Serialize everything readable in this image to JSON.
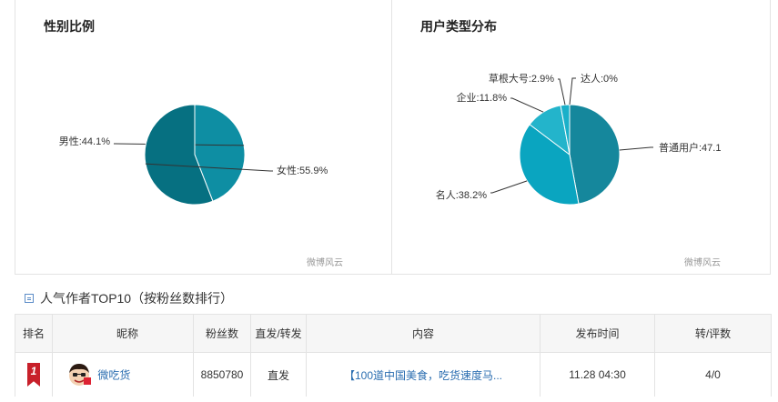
{
  "gender_panel": {
    "title": "性别比例",
    "watermark": "微博风云",
    "chart_data": {
      "type": "pie",
      "categories": [
        "男性",
        "女性"
      ],
      "values": [
        44.1,
        55.9
      ],
      "labels": [
        "男性:44.1%",
        "女性:55.9%"
      ],
      "colors": [
        "#0e8ea3",
        "#067081"
      ]
    }
  },
  "usertype_panel": {
    "title": "用户类型分布",
    "watermark": "微博风云",
    "chart_data": {
      "type": "pie",
      "categories": [
        "普通用户",
        "名人",
        "企业",
        "草根大号",
        "达人"
      ],
      "values": [
        47.1,
        38.2,
        11.8,
        2.9,
        0
      ],
      "labels": [
        "普通用户:47.1",
        "名人:38.2%",
        "企业:11.8%",
        "草根大号:2.9%",
        "达人:0%"
      ],
      "colors": [
        "#15879c",
        "#0aa5c0",
        "#23b4cb",
        "#1ab0c9",
        "#44c1d3"
      ]
    }
  },
  "top10": {
    "header": "人气作者TOP10（按粉丝数排行）",
    "columns": [
      "排名",
      "昵称",
      "粉丝数",
      "直发/转发",
      "内容",
      "发布时间",
      "转/评数"
    ],
    "rows": [
      {
        "rank": "1",
        "nickname": "微吃货",
        "avatar_icon": "cartoon-avatar-icon",
        "fans": "8850780",
        "type": "直发",
        "content": "【100道中国美食，吃货速度马...",
        "time": "11.28 04:30",
        "reposts_comments": "4/0"
      }
    ]
  }
}
